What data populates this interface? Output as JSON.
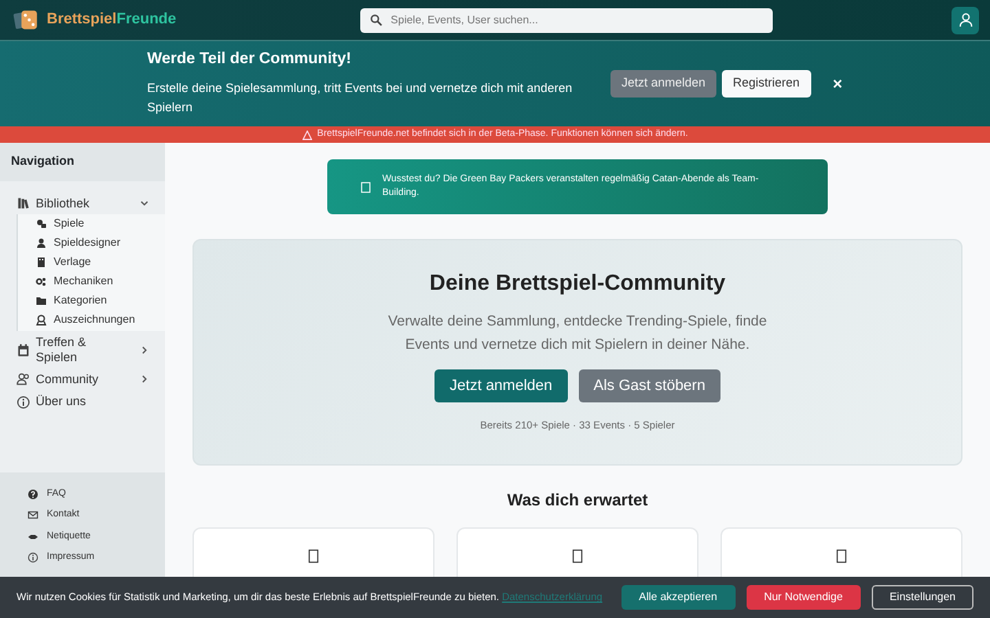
{
  "header": {
    "brand": {
      "part1": "Brettspiel",
      "part2": "Freunde"
    },
    "search": {
      "placeholder": "Spiele, Events, User suchen..."
    }
  },
  "join_banner": {
    "title": "Werde Teil der Community!",
    "text": "Erstelle deine Spielesammlung, tritt Events bei und vernetze dich mit anderen Spielern",
    "buttons": [
      {
        "label": "Jetzt anmelden",
        "kind": "secondary"
      },
      {
        "label": "Registrieren",
        "kind": "light"
      }
    ],
    "close": "×"
  },
  "beta_notice": "BrettspielFreunde.net befindet sich in der Beta-Phase. Funktionen können sich ändern.",
  "sidebar": {
    "title": "Navigation",
    "items": [
      {
        "label": "Bibliothek",
        "expanded": true,
        "children": [
          {
            "label": "Spiele"
          },
          {
            "label": "Spieldesigner"
          },
          {
            "label": "Verlage"
          },
          {
            "label": "Mechaniken"
          },
          {
            "label": "Kategorien"
          },
          {
            "label": "Auszeichnungen"
          }
        ]
      },
      {
        "label": "Treffen & Spielen",
        "expanded": false
      },
      {
        "label": "Community",
        "expanded": false
      },
      {
        "label": "Über uns"
      }
    ],
    "footer_links": [
      {
        "label": "FAQ"
      },
      {
        "label": "Kontakt"
      },
      {
        "label": "Netiquette"
      },
      {
        "label": "Impressum"
      }
    ]
  },
  "fact": "Wusstest du? Die Green Bay Packers veranstalten regelmäßig Catan-Abende als Team-Building.",
  "hero": {
    "title": "Deine Brettspiel-Community",
    "text": "Verwalte deine Sammlung, entdecke Trending-Spiele, finde Events und vernetze dich mit Spielern in deiner Nähe.",
    "buttons": [
      {
        "label": "Jetzt anmelden",
        "kind": "primary"
      },
      {
        "label": "Als Gast stöbern",
        "kind": "secondary"
      }
    ],
    "stats": "Bereits 210+ Spiele · 33 Events · 5 Spieler"
  },
  "features": {
    "title": "Was dich erwartet",
    "cards": [
      {
        "kind": "feature"
      },
      {
        "kind": "feature"
      },
      {
        "kind": "feature"
      }
    ]
  },
  "cookie_bar": {
    "text": "Wir nutzen Cookies für Statistik und Marketing, um dir das beste Erlebnis auf BrettspielFreunde zu bieten.",
    "link": "Datenschutzerklärung",
    "buttons": [
      {
        "label": "Alle akzeptieren",
        "kind": "accept"
      },
      {
        "label": "Nur Notwendige",
        "kind": "reject"
      },
      {
        "label": "Einstellungen",
        "kind": "outline"
      }
    ]
  }
}
